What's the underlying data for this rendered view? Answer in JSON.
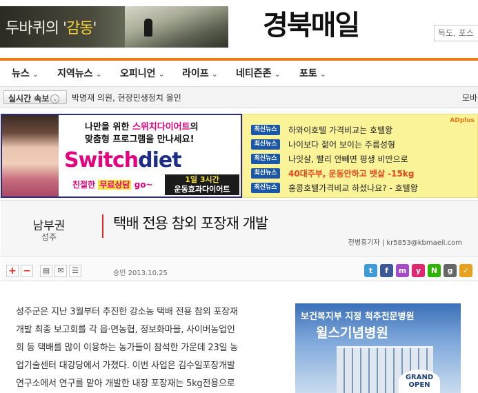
{
  "header": {
    "banner_text_a": "두바퀴의 '",
    "banner_text_accent": "감동",
    "banner_text_b": "'",
    "logo": "경북매일",
    "search_placeholder": "독도, 포스"
  },
  "nav": {
    "items": [
      {
        "label": "뉴스"
      },
      {
        "label": "지역뉴스"
      },
      {
        "label": "오피니언"
      },
      {
        "label": "라이프"
      },
      {
        "label": "네티즌존"
      },
      {
        "label": "포토"
      }
    ],
    "chevron": "⌄"
  },
  "breaking": {
    "button_label": "실시간 속보",
    "button_icon": "⌄",
    "headline": "박명재 의원, 현장민생정치 올인",
    "right_text": "모바"
  },
  "ad_switchdiet": {
    "line1_a": "나만을 위한 ",
    "line1_red": "스위치다이어트",
    "line1_b": "의",
    "line2": "맞춤형 프로그램을 만나세요!",
    "brand_a": "Switch",
    "brand_b": "diet",
    "consult_a": "친절한 ",
    "consult_hl": "무료상담",
    "consult_b": " go~",
    "badge_1": "1일 3시간",
    "badge_2": "운동효과다이어트"
  },
  "ad_news": {
    "brand": "ADplus",
    "tag": "최신뉴스",
    "items": [
      {
        "text": "하와이호텔 가격비교는 호텔왕",
        "hot": false
      },
      {
        "text": "나이보다 젊어 보이는 주름성형",
        "hot": false
      },
      {
        "text": "나잇살, 빨리 안빼면 평생 비만으로",
        "hot": false
      },
      {
        "text": "40대주부, 운동안하고 뱃살 -15kg",
        "hot": true
      },
      {
        "text": "홍콩호텔가격비교 하셨나요? - 호텔왕",
        "hot": false
      }
    ]
  },
  "article": {
    "section": "남부권",
    "sub_section": "성주",
    "title": "택배 전용 참외 포장재 개발",
    "byline": "전병휴기자  |  kr5853@kbmaeil.com",
    "published": "승인 2013.10.25",
    "font_plus": "+",
    "font_minus": "−",
    "body_lines": [
      "성주군은 지난 3월부터 추진한 강소농 택배 전용 참외 포장재",
      "개발 최종 보고회를 각 읍·면농협, 정보화마을, 사이버농업인",
      "회 등 택배를 많이 이용하는 농가들이 참석한 가운데 23일 농",
      "업기술센터 대강당에서 가졌다. 이번 사업은 김수일포장개발",
      "연구소에서 연구를 맡아 개발한 내장 포장재는 5kg전용으로"
    ]
  },
  "share": [
    {
      "icon": "twitter-icon",
      "glyph": "t",
      "color": "#3d9bd8"
    },
    {
      "icon": "facebook-icon",
      "glyph": "f",
      "color": "#3b5998"
    },
    {
      "icon": "me2day-icon",
      "glyph": "m",
      "color": "#a64bc7"
    },
    {
      "icon": "yozm-icon",
      "glyph": "y",
      "color": "#e0266e"
    },
    {
      "icon": "naver-icon",
      "glyph": "N",
      "color": "#2db400"
    },
    {
      "icon": "google-icon",
      "glyph": "g",
      "color": "#666666"
    },
    {
      "icon": "bookmark-icon",
      "glyph": "✓",
      "color": "#e7a11c"
    }
  ],
  "side_ad": {
    "line1": "보건복지부 지정 척추전문병원",
    "line2": "윌스기념병원",
    "grand_1": "GRAND",
    "grand_2": "OPEN"
  },
  "colors": {
    "accent_orange": "#ec7a15",
    "brand_pink": "#e4007f",
    "news_tag_blue": "#1a57a8",
    "ad_yellow": "#fbf398",
    "title_bar_red": "#e4291c"
  }
}
